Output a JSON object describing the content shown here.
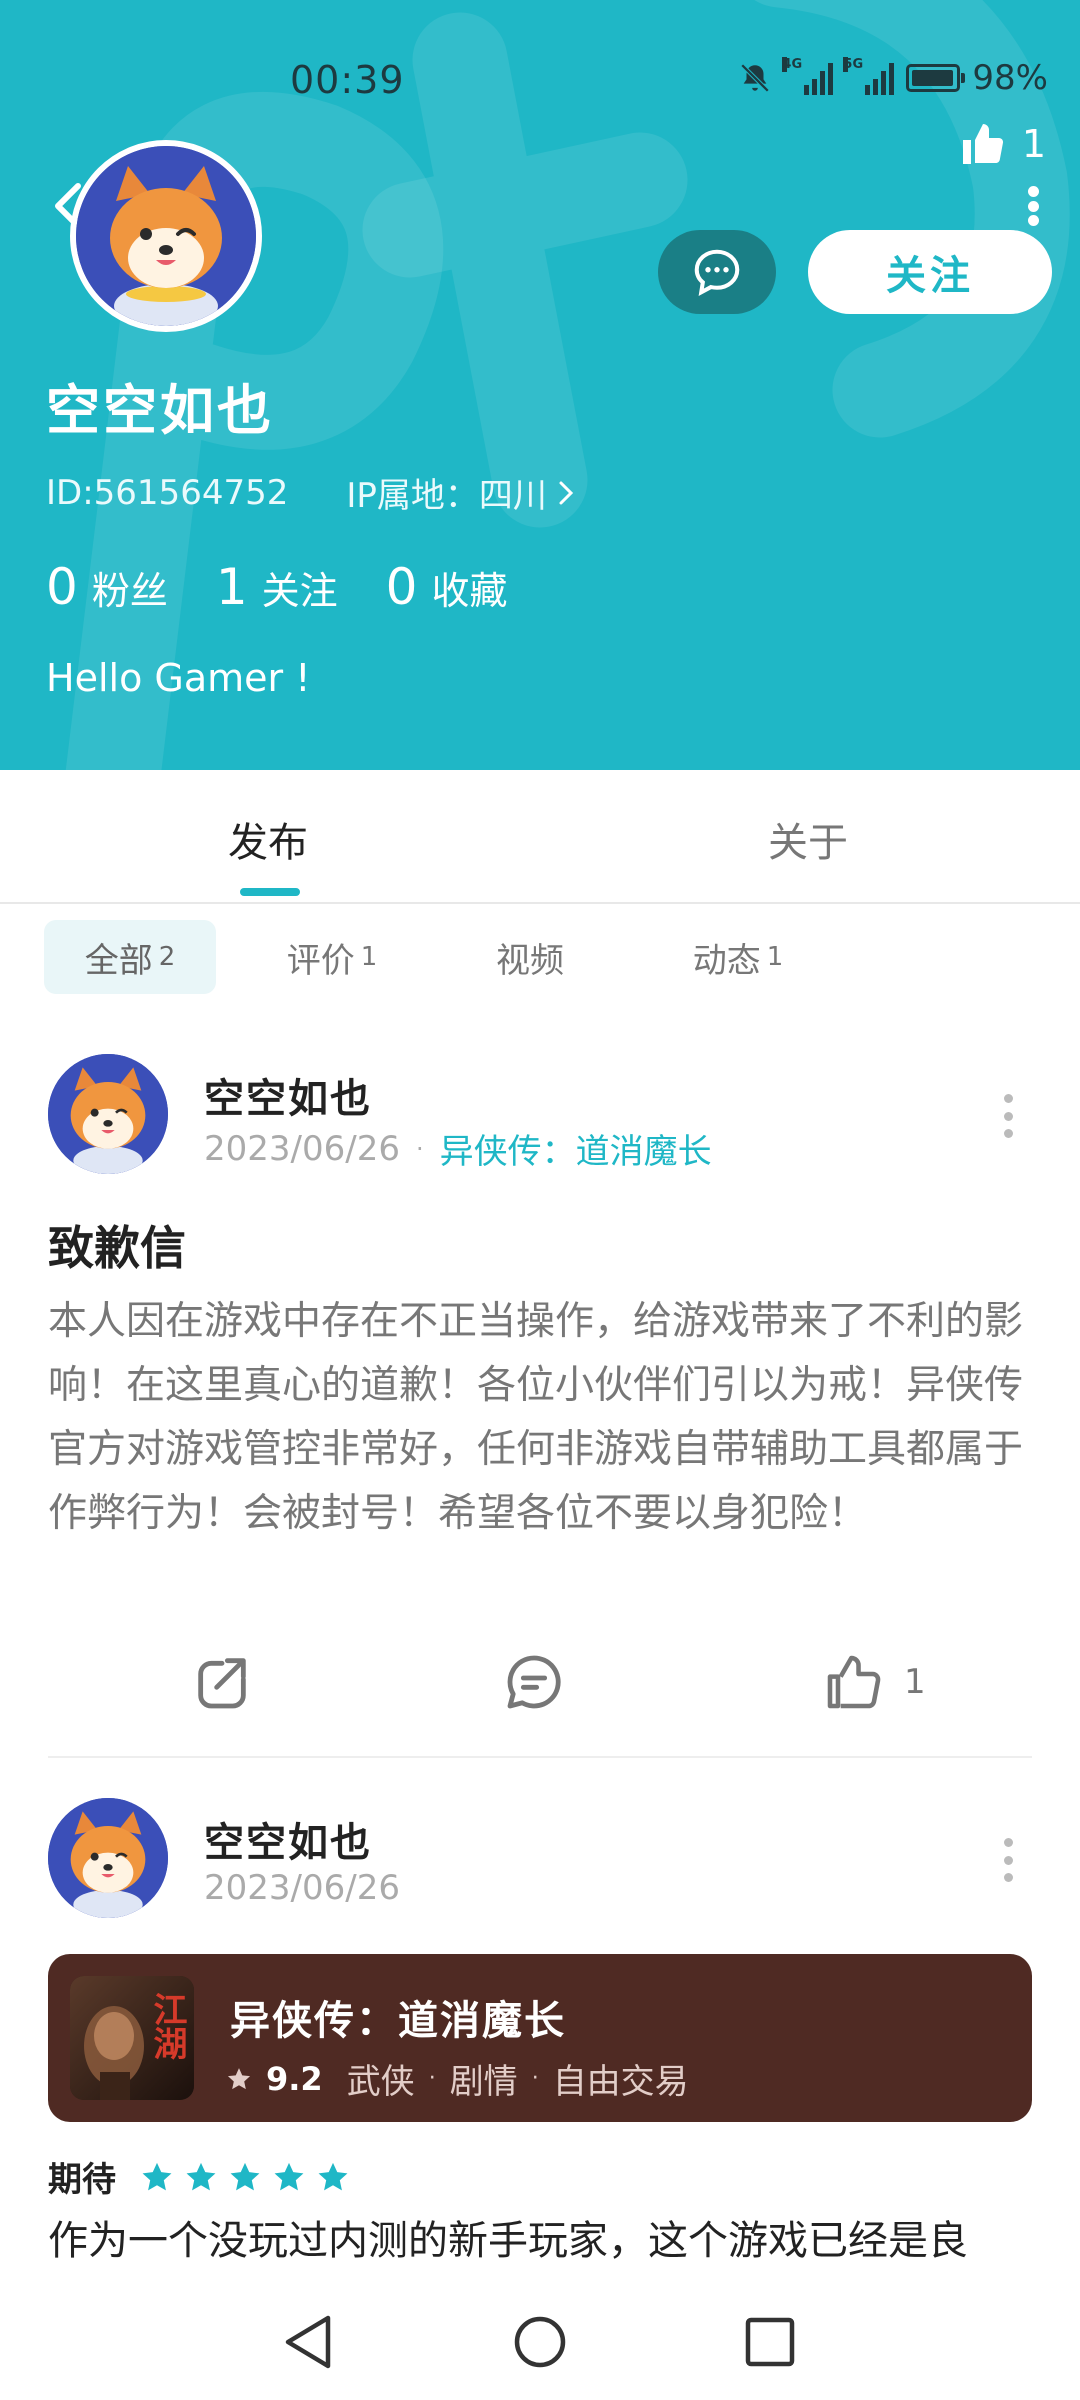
{
  "status_bar": {
    "time": "00:39",
    "net1": "4G",
    "net2": "5G",
    "battery_label": "98%",
    "battery_level": 0.98
  },
  "header": {
    "likes": "1",
    "follow_label": "关注",
    "name": "空空如也",
    "id_text": "ID:561564752",
    "ip_text": "IP属地：四川",
    "stats": [
      {
        "num": "0",
        "label": "粉丝"
      },
      {
        "num": "1",
        "label": "关注"
      },
      {
        "num": "0",
        "label": "收藏"
      }
    ],
    "bio": "Hello Gamer !",
    "accent": "#1fb7c6"
  },
  "tabs": {
    "publish": "发布",
    "about": "关于"
  },
  "filters": [
    {
      "label": "全部",
      "count": "2"
    },
    {
      "label": "评价",
      "count": "1"
    },
    {
      "label": "视频",
      "count": ""
    },
    {
      "label": "动态",
      "count": "1"
    }
  ],
  "post1": {
    "author": "空空如也",
    "date": "2023/06/26",
    "dot": "·",
    "game": "异侠传：道消魔长",
    "title": "致歉信",
    "body": "本人因在游戏中存在不正当操作，给游戏带来了不利的影响！在这里真心的道歉！各位小伙伴们引以为戒！异侠传官方对游戏管控非常好，任何非游戏自带辅助工具都属于作弊行为！会被封号！希望各位不要以身犯险！",
    "likes": "1"
  },
  "post2": {
    "author": "空空如也",
    "date": "2023/06/26",
    "card": {
      "name": "异侠传：道消魔长",
      "score": "9.2",
      "tag1": "武侠",
      "tag2": "剧情",
      "tag3": "自由交易",
      "sep": "·",
      "icon_text": "江湖"
    },
    "rating_label": "期待",
    "stars": 5,
    "review": "作为一个没玩过内测的新手玩家，这个游戏已经是良"
  }
}
